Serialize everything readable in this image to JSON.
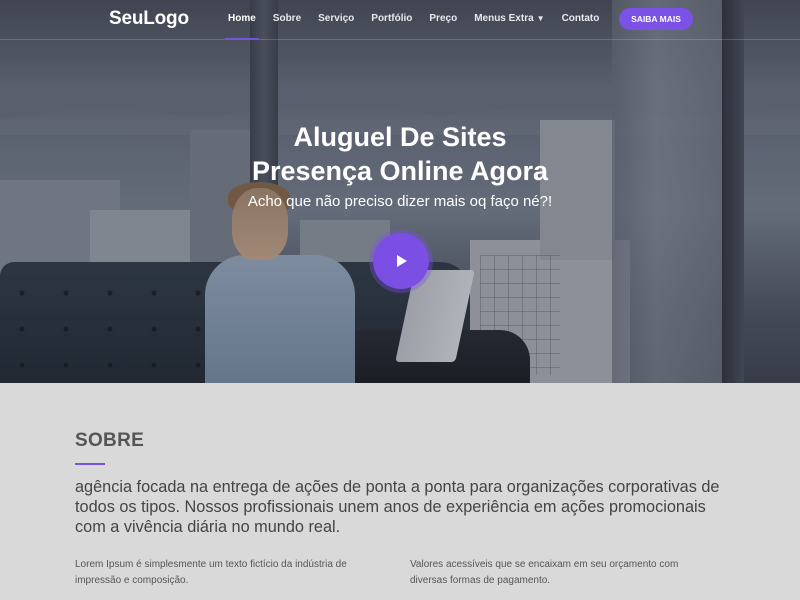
{
  "brand": {
    "logo": "SeuLogo",
    "accent": "#7a52e6"
  },
  "nav": {
    "items": [
      {
        "label": "Home",
        "active": true
      },
      {
        "label": "Sobre"
      },
      {
        "label": "Serviço"
      },
      {
        "label": "Portfólio"
      },
      {
        "label": "Preço"
      },
      {
        "label": "Menus Extra",
        "has_dropdown": true
      },
      {
        "label": "Contato"
      }
    ],
    "cta": "SAIBA MAIS"
  },
  "hero": {
    "title_line1": "Aluguel De Sites",
    "title_line2": "Presença Online Agora",
    "subtitle": "Acho que não preciso dizer mais oq faço né?!",
    "play_icon": "play-icon"
  },
  "about": {
    "heading": "SOBRE",
    "lead": "agência focada na entrega de ações de ponta a ponta para organizações corporativas de todos os tipos. Nossos profissionais unem anos de experiência em ações promocionais com a vivência diária no mundo real.",
    "col_left": "Lorem Ipsum é simplesmente um texto fictício da indústria de impressão e composição.",
    "col_right": "Valores acessíveis que se encaixam em seu orçamento com diversas formas de pagamento."
  }
}
